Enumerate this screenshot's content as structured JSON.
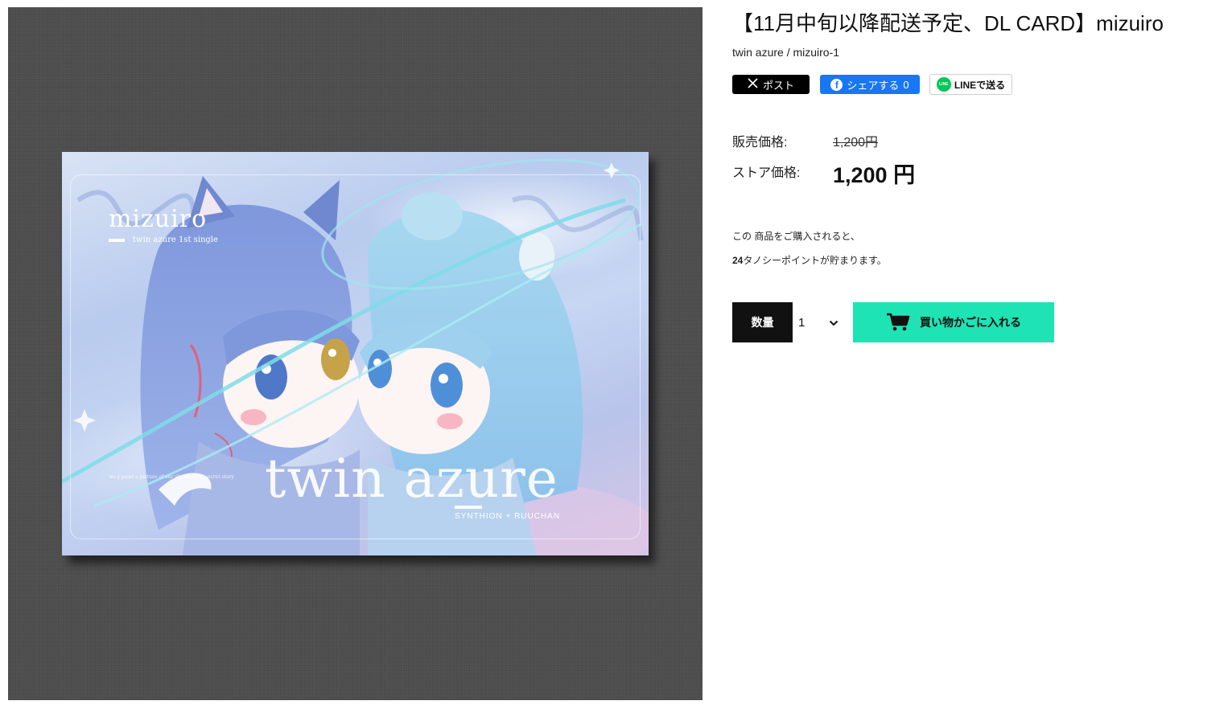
{
  "product": {
    "title": "【11月中旬以降配送予定、DL CARD】mizuiro",
    "breadcrumb": "twin azure / mizuiro-1"
  },
  "image": {
    "card_title": "mizuiro",
    "card_subtitle": "twin azure 1st single",
    "card_big_text": "twin azure",
    "card_credit": "SYNTHION + RUUCHAN",
    "card_lyrics": "we ∮ paint a picture of our sky and our secret story",
    "background_color": "#4d4d4d",
    "card_colors": [
      "#d9e3f5",
      "#b9cbee",
      "#b8c4ea",
      "#d7c6e6"
    ]
  },
  "share": {
    "x_label": "ポスト",
    "x_icon": "x-logo-icon",
    "fb_label": "シェアする",
    "fb_count": "0",
    "fb_icon": "facebook-icon",
    "line_label": "LINEで送る",
    "line_icon": "line-icon",
    "line_icon_text": "LINE"
  },
  "price": {
    "sale_label": "販売価格:",
    "sale_value": "1,200円",
    "store_label": "ストア価格:",
    "store_value": "1,200 円"
  },
  "points": {
    "line1": "この 商品をご購入されると、",
    "points_value": "24",
    "line2_suffix": "タノシーポイントが貯まります。"
  },
  "purchase": {
    "qty_label": "数量",
    "qty_value": "1",
    "cart_label": "買い物かごに入れる",
    "cart_icon": "cart-icon",
    "accent_color": "#1ee3b4"
  }
}
